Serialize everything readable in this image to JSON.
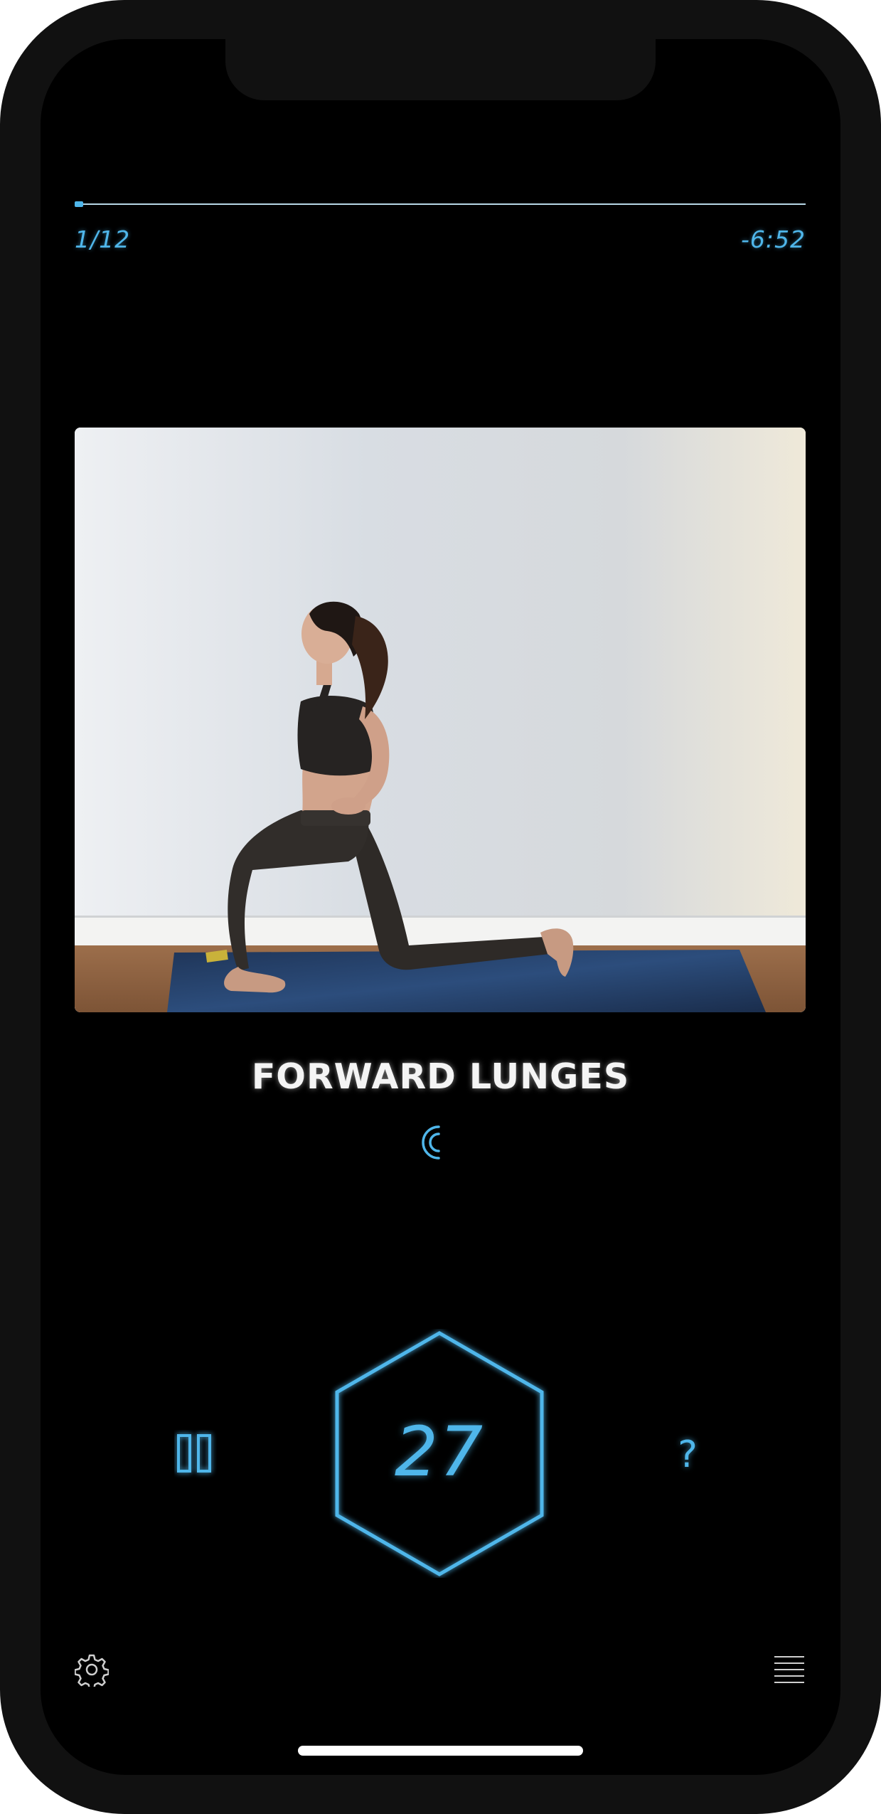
{
  "progress": {
    "counter": "1/12",
    "remaining_time": "-6:52",
    "fraction": 0.012
  },
  "exercise": {
    "title": "FORWARD LUNGES"
  },
  "controls": {
    "timer_value": "27",
    "help_label": "?"
  },
  "icons": {
    "spinner": "loading-spinner-icon",
    "pause": "pause-icon",
    "settings": "gear-icon",
    "menu": "list-menu-icon"
  },
  "colors": {
    "accent": "#4fb6ea",
    "background": "#000000",
    "title": "#f4f4f4"
  }
}
